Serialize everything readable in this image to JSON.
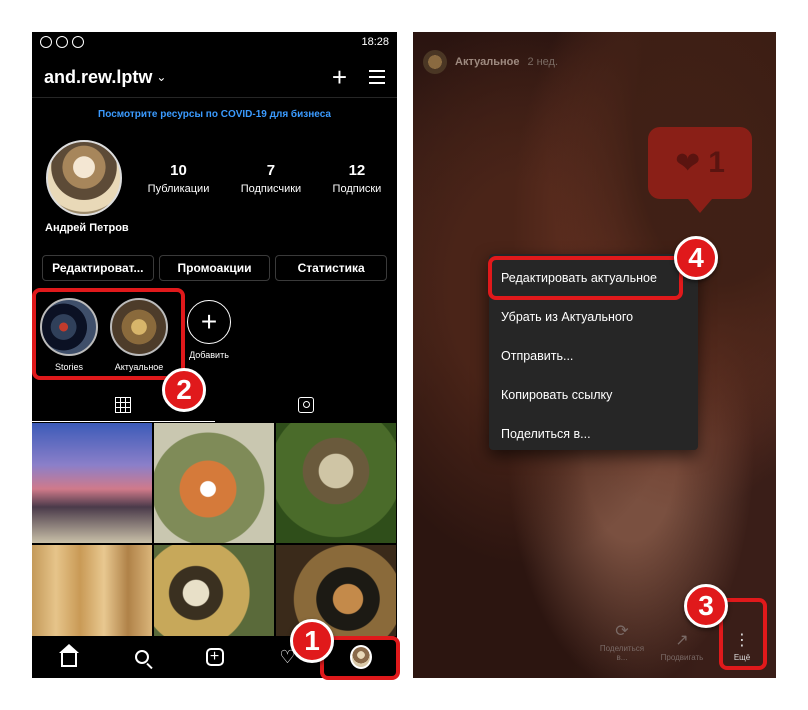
{
  "left": {
    "status_time": "18:28",
    "username": "and.rew.lptw",
    "covid_banner": "Посмотрите ресурсы по COVID-19 для бизнеса",
    "stats": [
      {
        "value": "10",
        "label": "Публикации"
      },
      {
        "value": "7",
        "label": "Подписчики"
      },
      {
        "value": "12",
        "label": "Подписки"
      }
    ],
    "full_name": "Андрей Петров",
    "buttons": {
      "edit": "Редактироват...",
      "promo": "Промоакции",
      "stats": "Статистика"
    },
    "highlights": [
      {
        "label": "Stories"
      },
      {
        "label": "Актуальное"
      },
      {
        "label": "Добавить"
      }
    ],
    "add_glyph": "+",
    "badges": {
      "one": "1",
      "two": "2"
    }
  },
  "right": {
    "story_name": "Актуальное",
    "story_time": "2 нед.",
    "like_count": "1",
    "menu_items": [
      "Редактировать актуальное",
      "Убрать из Актуального",
      "Отправить...",
      "Копировать ссылку",
      "Поделиться в..."
    ],
    "footer": {
      "share": "Поделиться в...",
      "send": "Продвигать",
      "more": "Ещё"
    },
    "badges": {
      "three": "3",
      "four": "4"
    }
  },
  "colors": {
    "highlight_red": "#e0191b",
    "link_blue": "#3b9bff",
    "menu_bg": "#262626"
  }
}
